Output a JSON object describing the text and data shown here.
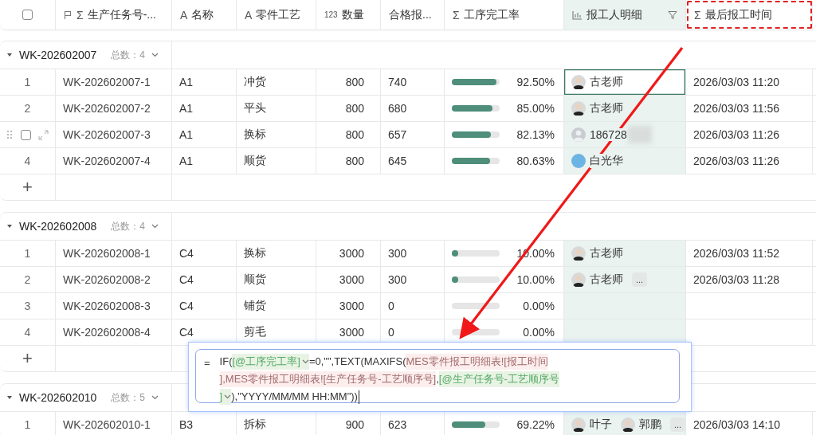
{
  "columns": [
    {
      "kind": "select",
      "checked": false
    },
    {
      "label": "生产任务号-...",
      "kind": "primary",
      "glyph": "Σ"
    },
    {
      "label": "名称",
      "kind": "plain",
      "glyph": "A"
    },
    {
      "label": "零件工艺",
      "kind": "plain",
      "glyph": "A"
    },
    {
      "label": "数量",
      "kind": "plain",
      "glyph": "123"
    },
    {
      "label": "合格报...",
      "kind": "plain"
    },
    {
      "label": "工序完工率",
      "kind": "plain",
      "glyph": "Σ"
    },
    {
      "label": "报工人明细",
      "kind": "lookup",
      "filtered": true,
      "highlighted": true
    },
    {
      "label": "最后报工时间",
      "kind": "plain",
      "glyph": "Σ",
      "annotated": true
    }
  ],
  "groups": [
    {
      "title": "WK-202602007",
      "count": "总数：4",
      "expanded": true,
      "rows": [
        {
          "number": "1",
          "task": "WK-202602007-1",
          "name": "A1",
          "process": "冲货",
          "qty": "800",
          "passed": "740",
          "rate": "92.50%",
          "level": 0.925,
          "reporters": [
            {
              "name": "古老师",
              "kind": "photo"
            }
          ],
          "more": false,
          "time": "2026/03/03 11:20",
          "hovered": false,
          "selected": true
        },
        {
          "number": "2",
          "task": "WK-202602007-2",
          "name": "A1",
          "process": "平头",
          "qty": "800",
          "passed": "680",
          "rate": "85.00%",
          "level": 0.85,
          "reporters": [
            {
              "name": "古老师",
              "kind": "photo"
            }
          ],
          "more": false,
          "time": "2026/03/03 11:56",
          "hovered": false,
          "selected": false
        },
        {
          "task": "WK-202602007-3",
          "name": "A1",
          "process": "换标",
          "qty": "800",
          "passed": "657",
          "rate": "82.13%",
          "level": 0.8213,
          "reporters": [
            {
              "name": "186728",
              "kind": "default",
              "redacted": true
            }
          ],
          "more": false,
          "time": "2026/03/03 11:26",
          "hovered": true,
          "checked": false,
          "selected": false
        },
        {
          "number": "4",
          "task": "WK-202602007-4",
          "name": "A1",
          "process": "顺货",
          "qty": "800",
          "passed": "645",
          "rate": "80.63%",
          "level": 0.8063,
          "reporters": [
            {
              "name": "白光华",
              "kind": "initials",
              "color": "#6cb4e4"
            }
          ],
          "more": false,
          "time": "2026/03/03 11:26",
          "hovered": false,
          "selected": false
        }
      ],
      "add_row": "+"
    },
    {
      "title": "WK-202602008",
      "count": "总数：4",
      "expanded": true,
      "rows": [
        {
          "number": "1",
          "task": "WK-202602008-1",
          "name": "C4",
          "process": "换标",
          "qty": "3000",
          "passed": "300",
          "rate": "10.00%",
          "level": 0.1,
          "reporters": [
            {
              "name": "古老师",
              "kind": "photo"
            }
          ],
          "more": false,
          "time": "2026/03/03 11:52",
          "hovered": false,
          "selected": false
        },
        {
          "number": "2",
          "task": "WK-202602008-2",
          "name": "C4",
          "process": "顺货",
          "qty": "3000",
          "passed": "300",
          "rate": "10.00%",
          "level": 0.1,
          "reporters": [
            {
              "name": "古老师",
              "kind": "photo"
            }
          ],
          "more": true,
          "time": "2026/03/03 11:28",
          "hovered": false,
          "selected": false
        },
        {
          "number": "3",
          "task": "WK-202602008-3",
          "name": "C4",
          "process": "铺货",
          "qty": "3000",
          "passed": "0",
          "rate": "0.00%",
          "level": 0,
          "reporters": [],
          "more": false,
          "hovered": false,
          "selected": false
        },
        {
          "number": "4",
          "task": "WK-202602008-4",
          "name": "C4",
          "process": "剪毛",
          "qty": "3000",
          "passed": "0",
          "rate": "0.00%",
          "level": 0,
          "reporters": [],
          "more": false,
          "hovered": false,
          "selected": false
        }
      ],
      "add_row": "+"
    },
    {
      "title": "WK-202602010",
      "count": "总数：5",
      "expanded": true,
      "rows": [
        {
          "number": "1",
          "task": "WK-202602010-1",
          "name": "B3",
          "process": "拆标",
          "qty": "900",
          "passed": "623",
          "rate": "69.22%",
          "level": 0.6922,
          "reporters": [
            {
              "name": "叶子",
              "kind": "photo"
            },
            {
              "name": "郭鹏",
              "kind": "photo"
            }
          ],
          "more": true,
          "time": "2026/03/03 14:10",
          "hovered": false,
          "selected": false
        }
      ]
    }
  ],
  "more_label": "...",
  "formula": {
    "prefix": "=",
    "lines": [
      [
        {
          "kind": "plain",
          "text": "IF("
        },
        {
          "kind": "field",
          "text": "[@工序完工率]",
          "dropdown": true
        },
        {
          "kind": "plain",
          "text": "=0,\"\",TEXT(MAXIFS("
        },
        {
          "kind": "table",
          "text": "MES零件报工明细表![报工时间"
        }
      ],
      [
        {
          "kind": "table",
          "text": "],MES零件报工明细表![生产任务号-工艺顺序号]"
        },
        {
          "kind": "plain",
          "text": ","
        },
        {
          "kind": "field",
          "text": "[@生产任务号-工艺顺序号",
          "dropdown": false
        }
      ],
      [
        {
          "kind": "field",
          "text": "]",
          "dropdown": true
        },
        {
          "kind": "plain",
          "text": "),\"YYYY/MM/MM HH:MM\"))"
        }
      ]
    ],
    "cursor": true
  },
  "annotations": [
    {
      "kind": "arrow"
    }
  ]
}
